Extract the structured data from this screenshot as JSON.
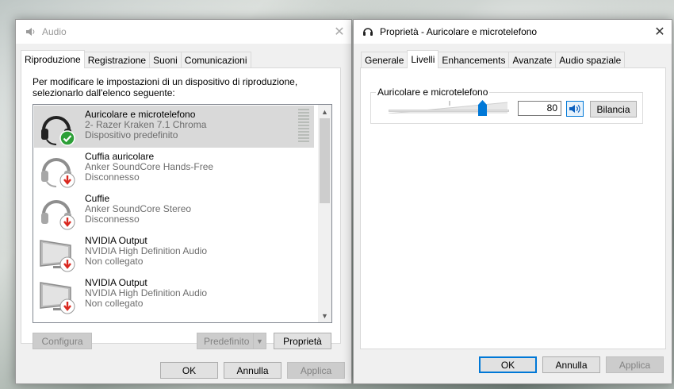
{
  "audio_window": {
    "title": "Audio",
    "tabs": [
      {
        "label": "Riproduzione",
        "active": true
      },
      {
        "label": "Registrazione",
        "active": false
      },
      {
        "label": "Suoni",
        "active": false
      },
      {
        "label": "Comunicazioni",
        "active": false
      }
    ],
    "description": "Per modificare le impostazioni di un dispositivo di riproduzione, selezionarlo dall'elenco seguente:",
    "devices": [
      {
        "name": "Auricolare e microtelefono",
        "detail": "2- Razer Kraken 7.1 Chroma",
        "status": "Dispositivo predefinito",
        "icon": "headset-icon",
        "badge": "check-badge-icon",
        "selected": true
      },
      {
        "name": "Cuffia auricolare",
        "detail": "Anker SoundCore Hands-Free",
        "status": "Disconnesso",
        "icon": "headset-icon",
        "badge": "down-arrow-badge-icon",
        "selected": false
      },
      {
        "name": "Cuffie",
        "detail": "Anker SoundCore Stereo",
        "status": "Disconnesso",
        "icon": "headphones-icon",
        "badge": "down-arrow-badge-icon",
        "selected": false
      },
      {
        "name": "NVIDIA Output",
        "detail": "NVIDIA High Definition Audio",
        "status": "Non collegato",
        "icon": "monitor-icon",
        "badge": "down-arrow-badge-icon",
        "selected": false
      },
      {
        "name": "NVIDIA Output",
        "detail": "NVIDIA High Definition Audio",
        "status": "Non collegato",
        "icon": "monitor-icon",
        "badge": "down-arrow-badge-icon",
        "selected": false
      }
    ],
    "buttons": {
      "configure": "Configura",
      "default": "Predefinito",
      "properties": "Proprietà",
      "ok": "OK",
      "cancel": "Annulla",
      "apply": "Applica"
    }
  },
  "properties_window": {
    "title": "Proprietà - Auricolare e microtelefono",
    "tabs": [
      {
        "label": "Generale",
        "active": false
      },
      {
        "label": "Livelli",
        "active": true
      },
      {
        "label": "Enhancements",
        "active": false
      },
      {
        "label": "Avanzate",
        "active": false
      },
      {
        "label": "Audio spaziale",
        "active": false
      }
    ],
    "level_group_label": "Auricolare e microtelefono",
    "volume": 80,
    "volume_text": "80",
    "buttons": {
      "balance": "Bilancia",
      "ok": "OK",
      "cancel": "Annulla",
      "apply": "Applica"
    }
  },
  "colors": {
    "accent": "#0078d7",
    "selected_row": "#d9d9d9",
    "badge_green": "#2d9f38",
    "badge_red": "#d9281f"
  }
}
